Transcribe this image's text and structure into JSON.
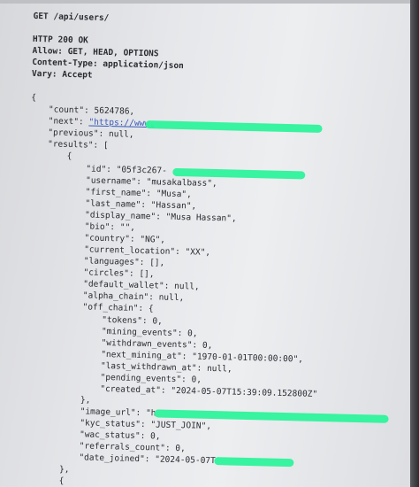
{
  "request": {
    "line": "GET /api/users/"
  },
  "response": {
    "status": "HTTP 200 OK",
    "headers": [
      "Allow: GET, HEAD, OPTIONS",
      "Content-Type: application/json",
      "Vary: Accept"
    ]
  },
  "body": {
    "open_brace": "{",
    "count": "\"count\": 5624786,",
    "next": "\"next\": ",
    "next_url": "\"https://www.",
    "previous": "\"previous\": null,",
    "results_open": "\"results\": [",
    "item_open": "{",
    "id": "\"id\": \"05f3c267-",
    "username": "\"username\": \"musakalbass\",",
    "first_name": "\"first_name\": \"Musa\",",
    "last_name": "\"last_name\": \"Hassan\",",
    "display_name": "\"display_name\": \"Musa Hassan\",",
    "bio": "\"bio\": \"\",",
    "country": "\"country\": \"NG\",",
    "current_location": "\"current_location\": \"XX\",",
    "languages": "\"languages\": [],",
    "circles": "\"circles\": [],",
    "default_wallet": "\"default_wallet\": null,",
    "alpha_chain": "\"alpha_chain\": null,",
    "off_chain_open": "\"off_chain\": {",
    "tokens": "\"tokens\": 0,",
    "mining_events": "\"mining_events\": 0,",
    "withdrawn_events": "\"withdrawn_events\": 0,",
    "next_mining_at": "\"next_mining_at\": \"1970-01-01T00:00:00\",",
    "last_withdrawn_at": "\"last_withdrawn_at\": null,",
    "pending_events": "\"pending_events\": 0,",
    "created_at": "\"created_at\": \"2024-05-07T15:39:09.152800Z\"",
    "off_chain_close": "},",
    "image_url": "\"image_url\": \"h",
    "kyc_status": "\"kyc_status\": \"JUST_JOIN\",",
    "wac_status": "\"wac_status\": 0,",
    "referrals_count": "\"referrals_count\": 0,",
    "date_joined": "\"date_joined\": \"2024-05-07T",
    "item_close": "},",
    "next_item_open": "{"
  }
}
